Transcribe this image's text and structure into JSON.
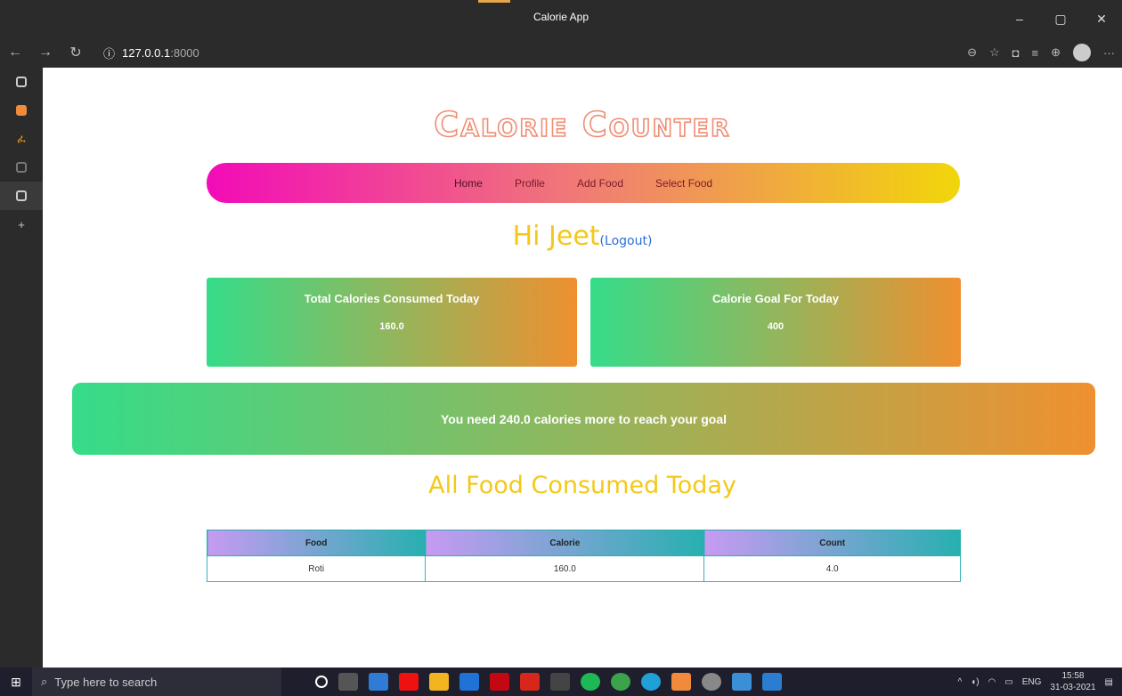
{
  "window": {
    "title": "Calorie App",
    "buttons": [
      "–",
      "▢",
      "✕"
    ]
  },
  "address": {
    "host": "127.0.0.1",
    "port": ":8000"
  },
  "brand": "Calorie Counter",
  "nav": {
    "home": "Home",
    "profile": "Profile",
    "add_food": "Add Food",
    "select_food": "Select Food"
  },
  "greeting": {
    "text": "Hi Jeet",
    "logout": "(Logout)"
  },
  "cards": [
    {
      "title": "Total Calories Consumed Today",
      "value": "160.0"
    },
    {
      "title": "Calorie Goal For Today",
      "value": "400"
    }
  ],
  "banner": "You need 240.0 calories more to reach your goal",
  "section_title": "All Food Consumed Today",
  "table": {
    "headers": [
      "Food",
      "Calorie",
      "Count"
    ],
    "rows": [
      [
        "Roti",
        "160.0",
        "4.0"
      ]
    ]
  },
  "taskbar": {
    "search_placeholder": "Type here to search",
    "lang": "ENG",
    "time": "15:58",
    "date": "31-03-2021"
  },
  "colors": {
    "accent_yellow": "#f4c819",
    "nav_start": "#f20bb8",
    "nav_end": "#f1d60a",
    "card_start": "#35dc89",
    "card_end": "#ef9030"
  }
}
